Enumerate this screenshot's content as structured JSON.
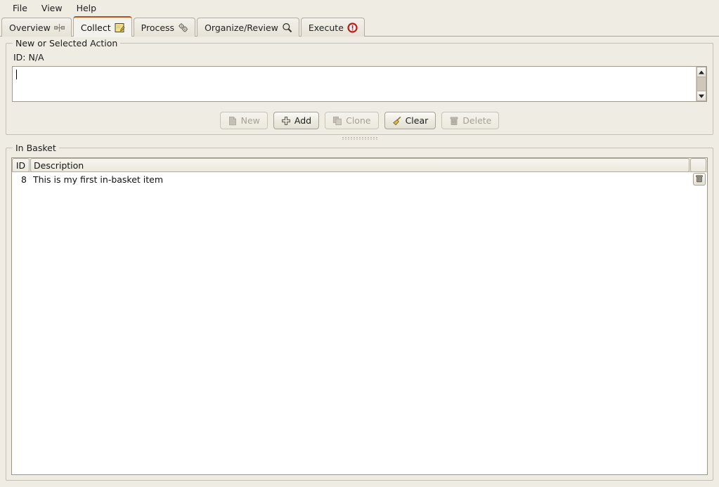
{
  "menu": {
    "items": [
      {
        "label": "File",
        "name": "menu-file"
      },
      {
        "label": "View",
        "name": "menu-view"
      },
      {
        "label": "Help",
        "name": "menu-help"
      }
    ]
  },
  "tabs": [
    {
      "label": "Overview",
      "icon": "network-node-icon",
      "active": false
    },
    {
      "label": "Collect",
      "icon": "note-pencil-icon",
      "active": true
    },
    {
      "label": "Process",
      "icon": "gears-icon",
      "active": false
    },
    {
      "label": "Organize/Review",
      "icon": "magnifier-icon",
      "active": false
    },
    {
      "label": "Execute",
      "icon": "stop-alert-icon",
      "active": false
    }
  ],
  "action_group": {
    "title": "New or Selected Action",
    "id_label": "ID: N/A",
    "textarea_value": "",
    "textarea_placeholder": ""
  },
  "buttons": [
    {
      "label": "New",
      "icon": "new-document-icon",
      "enabled": false
    },
    {
      "label": "Add",
      "icon": "plus-icon",
      "enabled": true
    },
    {
      "label": "Clone",
      "icon": "copy-icon",
      "enabled": false
    },
    {
      "label": "Clear",
      "icon": "broom-icon",
      "enabled": true
    },
    {
      "label": "Delete",
      "icon": "trash-icon",
      "enabled": false
    }
  ],
  "basket_group": {
    "title": "In Basket",
    "columns": [
      {
        "label": "ID"
      },
      {
        "label": "Description"
      },
      {
        "label": ""
      }
    ],
    "rows": [
      {
        "id": "8",
        "description": "This is my first in-basket item",
        "action_icon": "trash-icon"
      }
    ]
  },
  "colors": {
    "window_bg": "#efece4",
    "active_tab_accent": "#b3561a",
    "field_bg": "#ffffff",
    "border": "#b3ada1",
    "disabled_text": "#a5a097",
    "execute_icon": "#c21b17",
    "note_yellow": "#f2e08a"
  }
}
